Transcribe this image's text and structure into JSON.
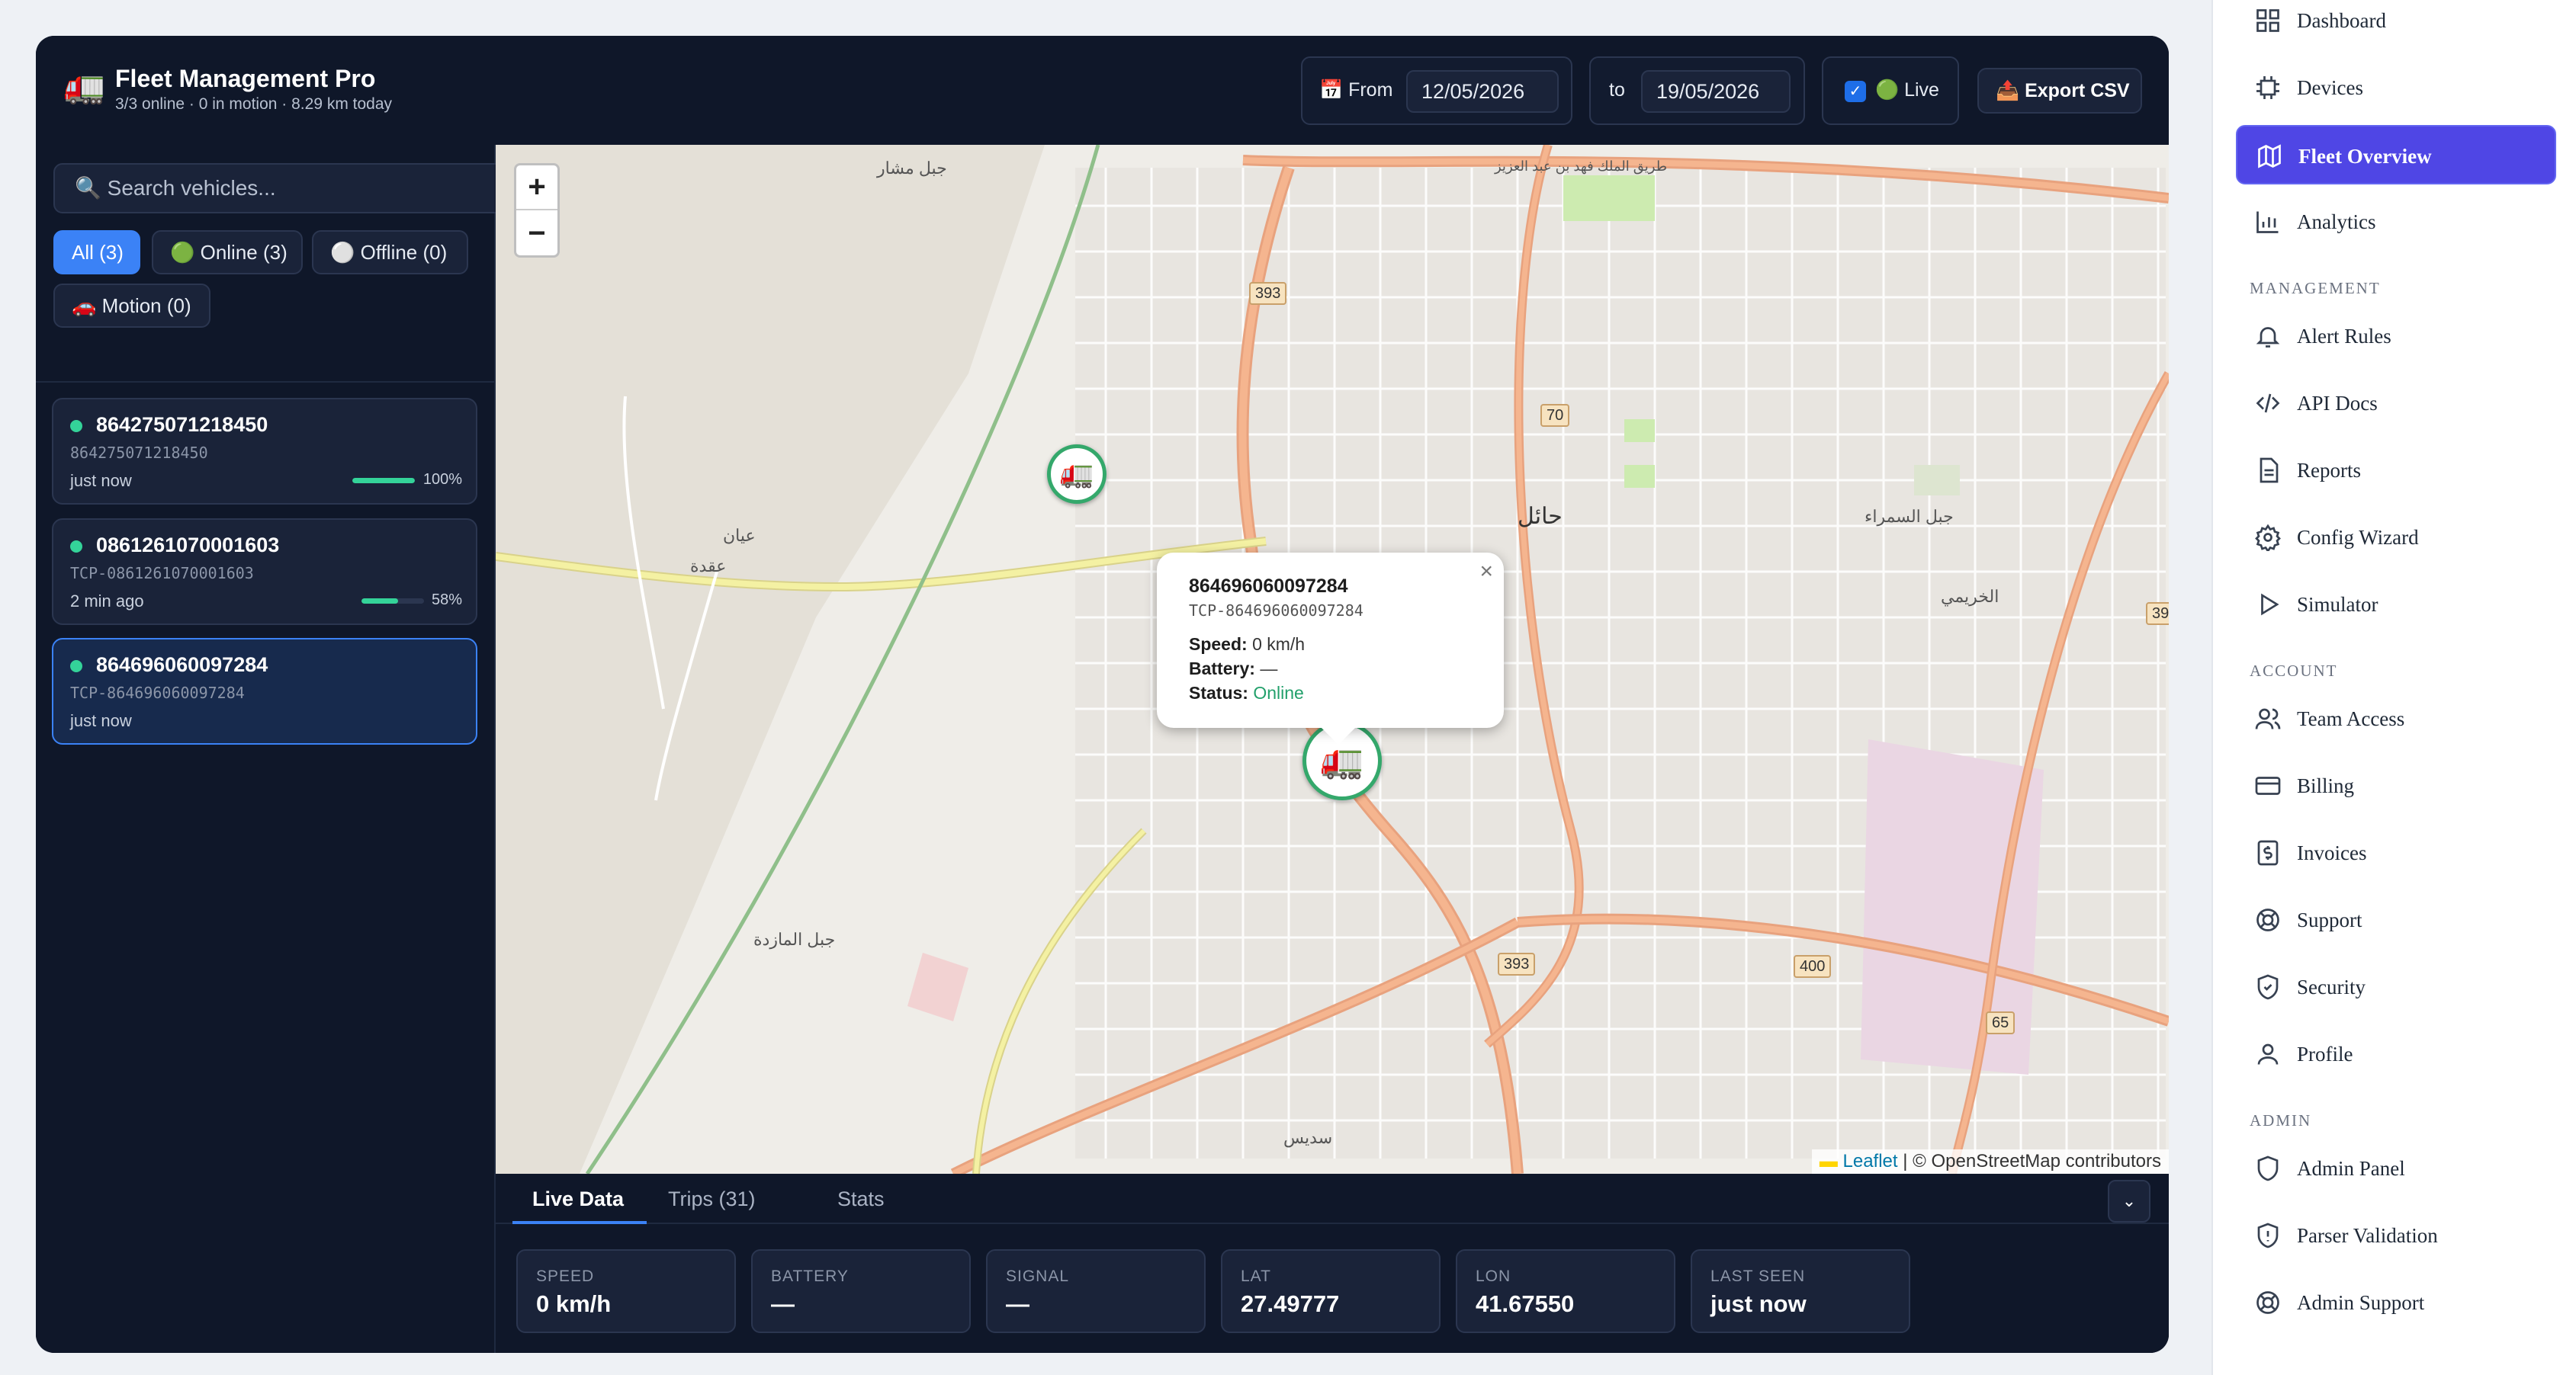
{
  "header": {
    "brand_icon": "truck-icon",
    "title": "Fleet Management Pro",
    "subtitle": "3/3 online · 0 in motion · 8.29 km today",
    "from_label": "📅 From",
    "from_date": "12/05/2026",
    "to_label": "to",
    "to_date": "19/05/2026",
    "live_label": "🟢 Live",
    "live_checked": true,
    "export_label": "📤 Export CSV"
  },
  "search": {
    "placeholder": "🔍 Search vehicles..."
  },
  "filters": {
    "all": "All (3)",
    "online": "🟢 Online (3)",
    "offline": "⚪ Offline (0)",
    "motion": "🚗 Motion (0)"
  },
  "vehicles": [
    {
      "name": "864275071218450",
      "id": "864275071218450",
      "time": "just now",
      "battery": "100%",
      "battery_level": 1.0
    },
    {
      "name": "0861261070001603",
      "id": "TCP-0861261070001603",
      "time": "2 min ago",
      "battery": "58%",
      "battery_level": 0.58
    },
    {
      "name": "864696060097284",
      "id": "TCP-864696060097284",
      "time": "just now",
      "battery": "",
      "battery_level": null
    }
  ],
  "map": {
    "zoom_in": "+",
    "zoom_out": "−",
    "popup": {
      "title": "864696060097284",
      "subtitle": "TCP-864696060097284",
      "speed_label": "Speed:",
      "speed": "0 km/h",
      "battery_label": "Battery:",
      "battery": "—",
      "status_label": "Status:",
      "status": "Online",
      "close": "×"
    },
    "attribution_link": "Leaflet",
    "attribution_flag": "▬",
    "attribution_text": "| © OpenStreetMap contributors",
    "labels": {
      "hail": "حائل",
      "jabal_samra": "جبل السمراء",
      "khuraimi": "الخريمي",
      "uqdah": "عقدة",
      "aban": "عيان",
      "jabal_mashar": "جبل مشار",
      "jabal_maidhiyah": "جبل المازدة",
      "sudays": "سديس",
      "road_north": "طريق الملك فهد بن عبد العزيز"
    },
    "shields": {
      "r393a": "393",
      "r70": "70",
      "r393b": "393",
      "r393c": "393",
      "r400": "400",
      "r65": "65"
    }
  },
  "bottom": {
    "tabs": [
      "Live Data",
      "Trips (31)",
      "Stats"
    ],
    "collapse": "⌄",
    "stats": [
      {
        "label": "SPEED",
        "value": "0 km/h"
      },
      {
        "label": "BATTERY",
        "value": "—"
      },
      {
        "label": "SIGNAL",
        "value": "—"
      },
      {
        "label": "LAT",
        "value": "27.49777"
      },
      {
        "label": "LON",
        "value": "41.67550"
      },
      {
        "label": "LAST SEEN",
        "value": "just now"
      }
    ]
  },
  "nav": {
    "items": [
      {
        "label": "Dashboard",
        "icon": "dashboard-icon"
      },
      {
        "label": "Devices",
        "icon": "chip-icon"
      },
      {
        "label": "Fleet Overview",
        "icon": "map-icon"
      },
      {
        "label": "Analytics",
        "icon": "bar-chart-icon"
      }
    ],
    "management_title": "MANAGEMENT",
    "management": [
      {
        "label": "Alert Rules",
        "icon": "bell-icon"
      },
      {
        "label": "API Docs",
        "icon": "code-icon"
      },
      {
        "label": "Reports",
        "icon": "document-icon"
      },
      {
        "label": "Config Wizard",
        "icon": "gear-icon"
      },
      {
        "label": "Simulator",
        "icon": "play-icon"
      }
    ],
    "account_title": "ACCOUNT",
    "account": [
      {
        "label": "Team Access",
        "icon": "users-icon"
      },
      {
        "label": "Billing",
        "icon": "credit-card-icon"
      },
      {
        "label": "Invoices",
        "icon": "invoice-icon"
      },
      {
        "label": "Support",
        "icon": "lifebuoy-icon"
      },
      {
        "label": "Security",
        "icon": "shield-icon"
      },
      {
        "label": "Profile",
        "icon": "user-icon"
      }
    ],
    "admin_title": "ADMIN",
    "admin": [
      {
        "label": "Admin Panel",
        "icon": "shield-outline-icon"
      },
      {
        "label": "Parser Validation",
        "icon": "shield-alert-icon"
      },
      {
        "label": "Admin Support",
        "icon": "lifebuoy-icon"
      }
    ]
  },
  "colors": {
    "accent": "#3b82f6",
    "nav_active": "#4f46e5",
    "online": "#34d399",
    "panel": "#0f1729"
  }
}
